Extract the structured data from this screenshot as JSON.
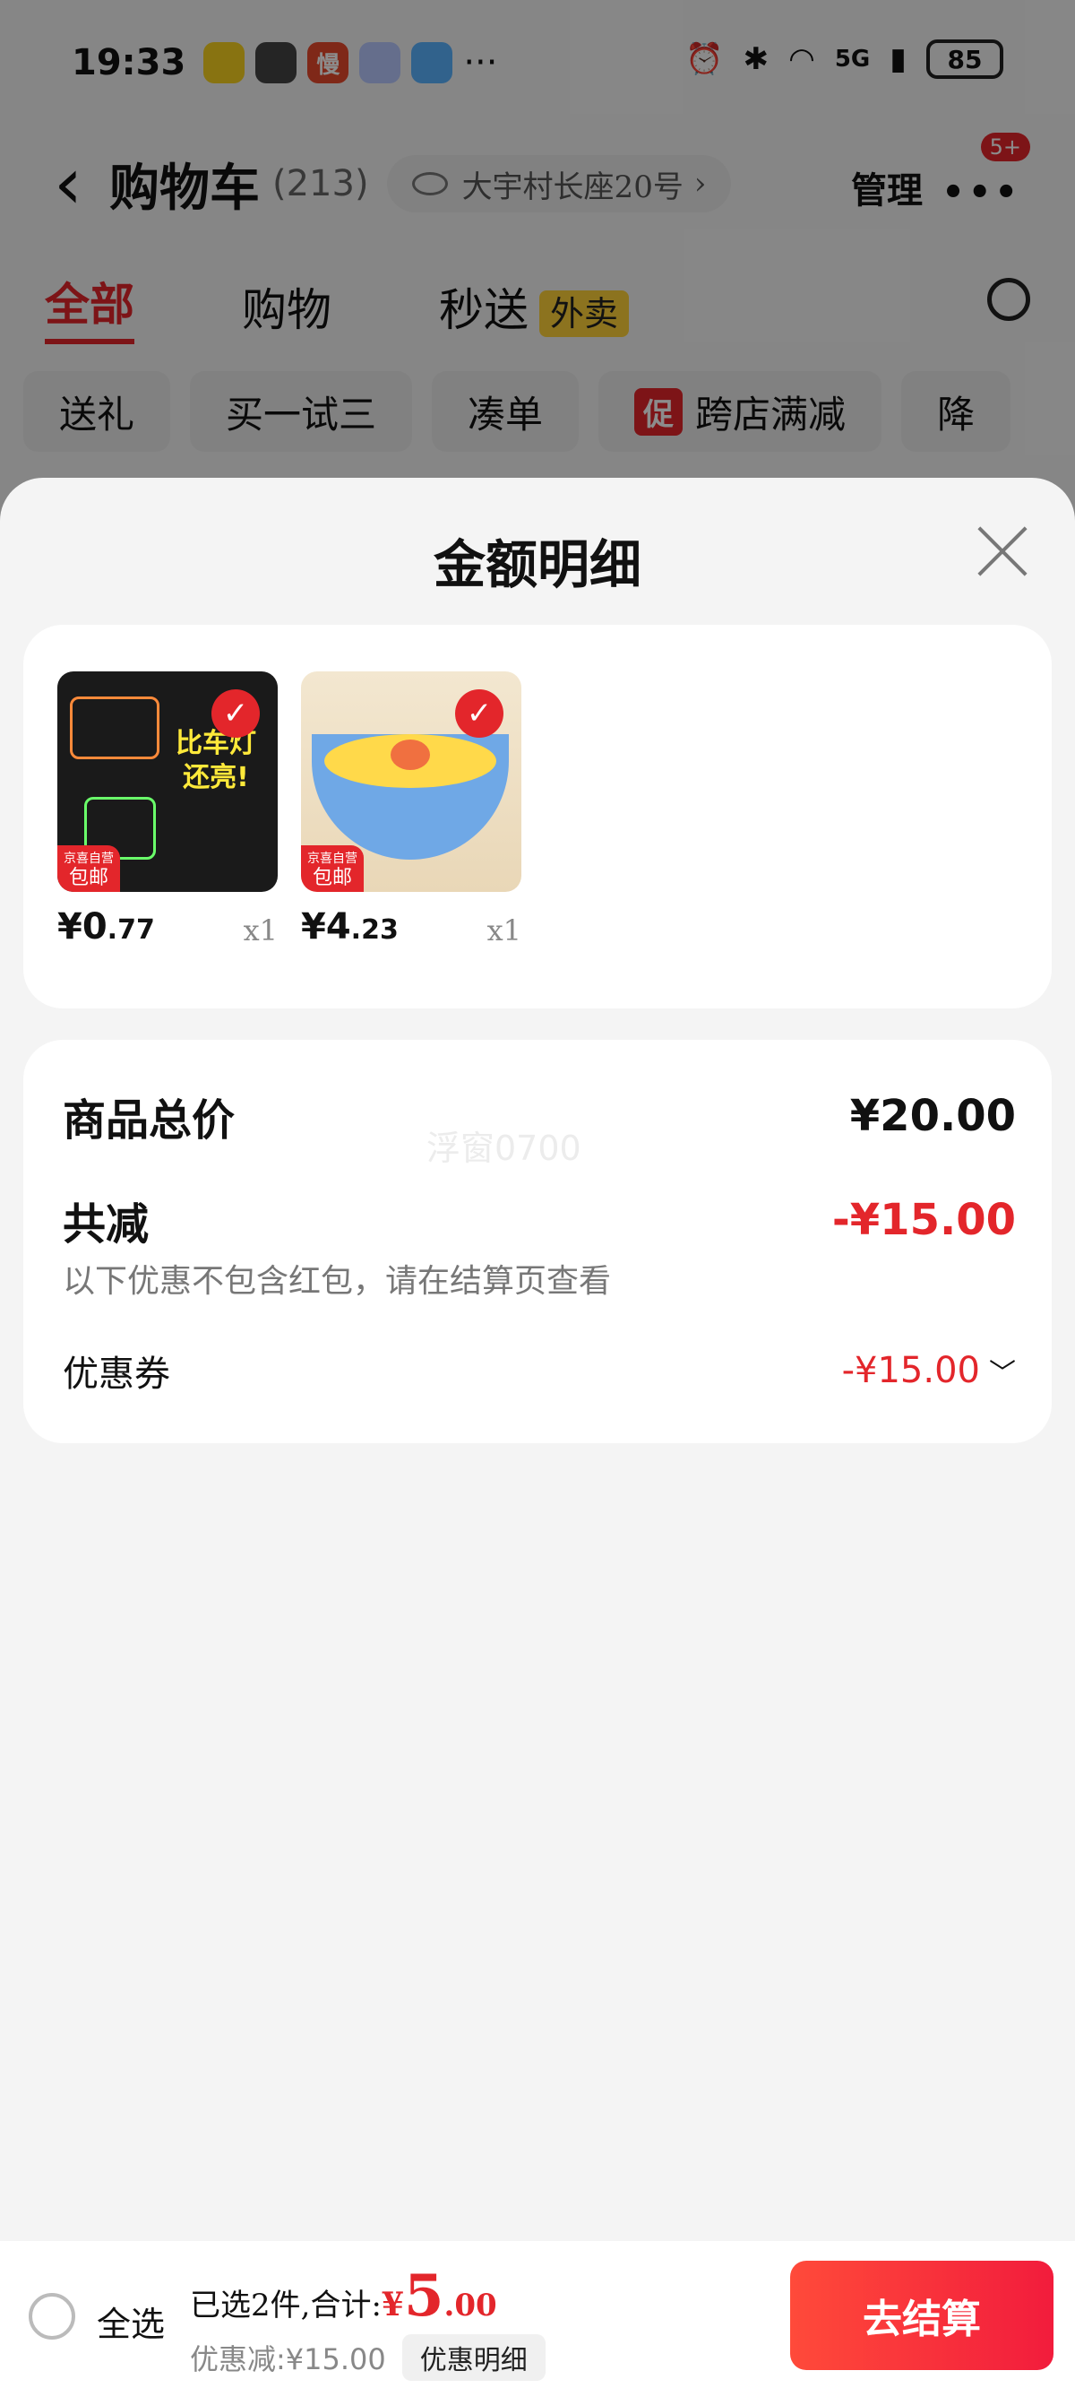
{
  "status_bar": {
    "time": "19:33",
    "apps": [
      {
        "name": "app-icon-yellow",
        "text": "",
        "color": "#f7d21f"
      },
      {
        "name": "wechat-icon",
        "text": "",
        "color": "#444444"
      },
      {
        "name": "app-icon-man",
        "text": "慢",
        "color": "#e84a2c"
      },
      {
        "name": "app-icon-ghost",
        "text": "",
        "color": "#b9c8ff"
      },
      {
        "name": "weather-icon",
        "text": "",
        "color": "#5ab2ff"
      }
    ],
    "more": "···",
    "network": "5G",
    "battery": "85"
  },
  "nav": {
    "title": "购物车",
    "count": "(213)",
    "address": "大宇村长座20号",
    "manage": "管理",
    "more_badge": "5+"
  },
  "tabs": [
    {
      "label": "全部",
      "active": true
    },
    {
      "label": "购物",
      "active": false
    },
    {
      "label": "秒送",
      "active": false,
      "tag": "外卖"
    }
  ],
  "chips": [
    {
      "label": "送礼"
    },
    {
      "label": "买一试三"
    },
    {
      "label": "凑单"
    },
    {
      "label": "跨店满减",
      "prefix": "促"
    },
    {
      "label": "降"
    }
  ],
  "sheet": {
    "title": "金额明细",
    "products": [
      {
        "price_int": "¥0",
        "price_dec": ".77",
        "qty": "x1",
        "badge_top": "京喜自营",
        "badge_bottom": "包邮",
        "thumb_text": "比车灯还亮!"
      },
      {
        "price_int": "¥4",
        "price_dec": ".23",
        "qty": "x1",
        "badge_top": "京喜自营",
        "badge_bottom": "包邮",
        "thumb_text": ""
      }
    ],
    "summary": {
      "total_label": "商品总价",
      "total_value": "¥20.00",
      "reduce_label": "共减",
      "reduce_value": "-¥15.00",
      "note": "以下优惠不包含红包，请在结算页查看",
      "coupon_label": "优惠券",
      "coupon_value": "-¥15.00",
      "watermark": "浮窗0700"
    }
  },
  "bottom": {
    "select_all": "全选",
    "selected_text": "已选2件,合计:",
    "total_yen": "¥",
    "total_int": "5",
    "total_dec": ".00",
    "discount_text": "优惠减:¥15.00",
    "detail_button": "优惠明细",
    "checkout": "去结算"
  },
  "colors": {
    "accent": "#e3262b",
    "waimai_tag": "#ffd23a"
  }
}
